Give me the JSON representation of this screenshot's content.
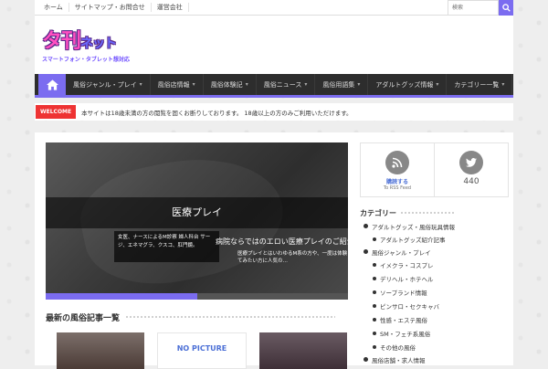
{
  "topbar": {
    "links": [
      "ホーム",
      "サイトマップ・お問合せ",
      "運営会社"
    ],
    "search_placeholder": "検索"
  },
  "logo": {
    "main": "タ刊",
    "sub": "ネット",
    "tagline": "スマートフォン・タブレット想対応"
  },
  "nav": {
    "items": [
      "風俗ジャンル・プレイ",
      "風俗店情報",
      "風俗体験記",
      "風俗ニュース",
      "風俗用語集",
      "アダルトグッズ情報",
      "カテゴリー一覧"
    ]
  },
  "ticker": {
    "badge": "WELCOME",
    "text": "本サイトは18歳未満の方の閲覧を固くお断りしております。 18歳以上の方のみご利用いただけます。"
  },
  "slider": {
    "title": "医療プレイ",
    "desc": "女医、ナースによるM診察 婦人科台 サージ、エネマグラ、クスコ、肛門鏡。",
    "headline": "病院ならではのエロい医療プレイのご紹介",
    "headline2": "医療プレイとはいわゆるM系の方や、一度は体験してみたい方に人気の…",
    "progress": 0.5
  },
  "section": {
    "title": "最新の風俗記事一覧"
  },
  "thumbs": {
    "nopic": "NO PICTURE"
  },
  "social": {
    "rss_label": "購読する",
    "rss_sub": "To RSS Feed",
    "twitter_count": "440"
  },
  "sidebar": {
    "title": "カテゴリー",
    "cats": [
      {
        "label": "アダルトグッズ・風俗玩具情報",
        "level": 0
      },
      {
        "label": "アダルトグッズ紹介記事",
        "level": 1
      },
      {
        "label": "風俗ジャンル・プレイ",
        "level": 0
      },
      {
        "label": "イメクラ・コスプレ",
        "level": 1
      },
      {
        "label": "デリヘル・ホテヘル",
        "level": 1
      },
      {
        "label": "ソープランド情報",
        "level": 1
      },
      {
        "label": "ピンサロ・セクキャバ",
        "level": 1
      },
      {
        "label": "性感・エステ風俗",
        "level": 1
      },
      {
        "label": "SM・フェチ系風俗",
        "level": 1
      },
      {
        "label": "その他の風俗",
        "level": 1
      },
      {
        "label": "風俗店舗・求人情報",
        "level": 0
      }
    ]
  },
  "colors": {
    "accent": "#7b6cf0",
    "nav_bg": "#2d2d2d",
    "badge": "#e33333"
  }
}
